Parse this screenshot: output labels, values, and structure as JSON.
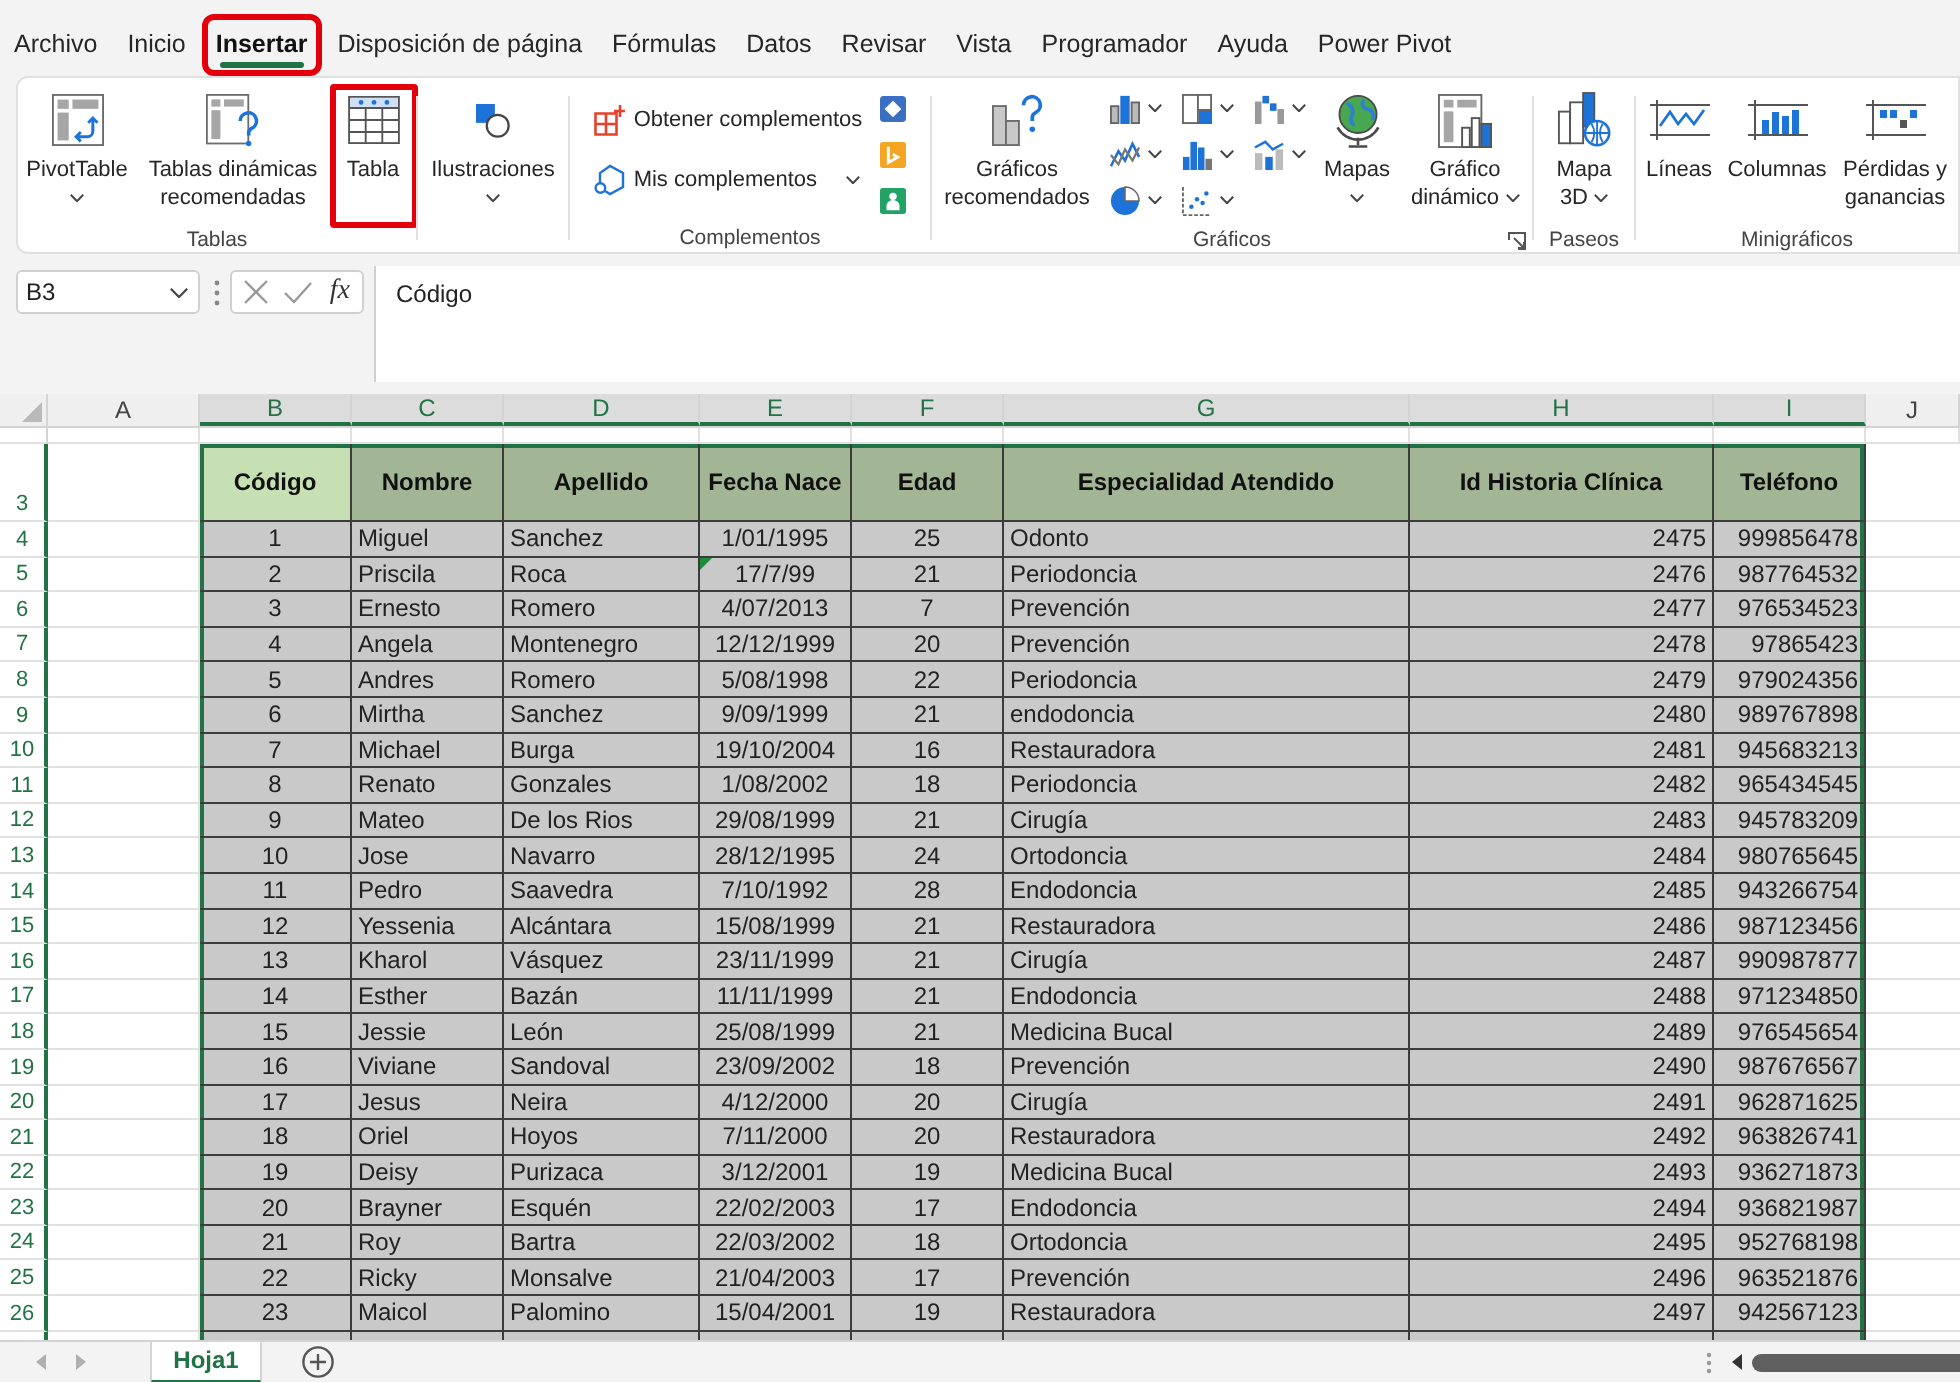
{
  "menu_tabs": [
    {
      "label": "Archivo",
      "selected": false,
      "highlighted": false
    },
    {
      "label": "Inicio",
      "selected": false,
      "highlighted": false
    },
    {
      "label": "Insertar",
      "selected": true,
      "highlighted": true
    },
    {
      "label": "Disposición de página",
      "selected": false,
      "highlighted": false
    },
    {
      "label": "Fórmulas",
      "selected": false,
      "highlighted": false
    },
    {
      "label": "Datos",
      "selected": false,
      "highlighted": false
    },
    {
      "label": "Revisar",
      "selected": false,
      "highlighted": false
    },
    {
      "label": "Vista",
      "selected": false,
      "highlighted": false
    },
    {
      "label": "Programador",
      "selected": false,
      "highlighted": false
    },
    {
      "label": "Ayuda",
      "selected": false,
      "highlighted": false
    },
    {
      "label": "Power Pivot",
      "selected": false,
      "highlighted": false
    }
  ],
  "ribbon_groups": [
    {
      "label": "Tablas",
      "dialog_launcher": false,
      "buttons": [
        {
          "kind": "large",
          "label": "PivotTable",
          "dropdown": true,
          "highlighted": false
        },
        {
          "kind": "large",
          "label": "Tablas dinámicas recomendadas",
          "dropdown": false,
          "highlighted": false
        },
        {
          "kind": "large",
          "label": "Tabla",
          "dropdown": false,
          "highlighted": true
        }
      ]
    },
    {
      "dialog_launcher": false,
      "buttons": [
        {
          "kind": "large",
          "label": "Ilustraciones",
          "dropdown": true,
          "highlighted": false
        }
      ]
    },
    {
      "label": "Complementos",
      "dialog_launcher": false,
      "buttons": [
        {
          "kind": "small",
          "label": "Obtener complementos",
          "dropdown": false,
          "highlighted": false
        },
        {
          "kind": "small",
          "label": "Mis complementos",
          "dropdown": true,
          "highlighted": false
        },
        {
          "kind": "icon",
          "dropdown": false,
          "highlighted": false
        },
        {
          "kind": "icon",
          "dropdown": false,
          "highlighted": false
        },
        {
          "kind": "icon",
          "dropdown": false,
          "highlighted": false
        }
      ]
    },
    {
      "label": "Gráficos",
      "dialog_launcher": true,
      "buttons": [
        {
          "kind": "large",
          "label": "Gráficos recomendados",
          "dropdown": false,
          "highlighted": false
        },
        {
          "kind": "icon",
          "dropdown": true,
          "highlighted": false
        },
        {
          "kind": "icon",
          "dropdown": true,
          "highlighted": false
        },
        {
          "kind": "icon",
          "dropdown": true,
          "highlighted": false
        },
        {
          "kind": "icon",
          "dropdown": true,
          "highlighted": false
        },
        {
          "kind": "icon",
          "dropdown": true,
          "highlighted": false
        },
        {
          "kind": "icon",
          "dropdown": true,
          "highlighted": false
        },
        {
          "kind": "icon",
          "dropdown": true,
          "highlighted": false
        },
        {
          "kind": "icon",
          "dropdown": true,
          "highlighted": false
        },
        {
          "kind": "large",
          "label": "Mapas",
          "dropdown": true,
          "highlighted": false
        },
        {
          "kind": "large",
          "label": "Gráfico dinámico",
          "dropdown": true,
          "highlighted": false
        }
      ]
    },
    {
      "label": "Paseos",
      "dialog_launcher": false,
      "buttons": [
        {
          "kind": "large",
          "label": "Mapa 3D",
          "dropdown": true,
          "highlighted": false
        }
      ]
    },
    {
      "label": "Minigráficos",
      "dialog_launcher": false,
      "buttons": [
        {
          "kind": "large",
          "label": "Líneas",
          "dropdown": false,
          "highlighted": false
        },
        {
          "kind": "large",
          "label": "Columnas",
          "dropdown": false,
          "highlighted": false
        },
        {
          "kind": "large",
          "label": "Pérdidas y ganancias",
          "dropdown": false,
          "highlighted": false
        }
      ]
    }
  ],
  "formula_bar": {
    "name_box": "B3",
    "function_button": "fx",
    "formula": "Código"
  },
  "column_headers": [
    {
      "label": "A",
      "selected": false
    },
    {
      "label": "B",
      "selected": true
    },
    {
      "label": "C",
      "selected": true
    },
    {
      "label": "D",
      "selected": true
    },
    {
      "label": "E",
      "selected": true
    },
    {
      "label": "F",
      "selected": true
    },
    {
      "label": "G",
      "selected": true
    },
    {
      "label": "H",
      "selected": true
    },
    {
      "label": "I",
      "selected": true
    },
    {
      "label": "J",
      "selected": false
    }
  ],
  "table": {
    "header": {
      "row_number": "3",
      "selected": true,
      "cells": [
        {
          "text": "Código",
          "active": true
        },
        {
          "text": "Nombre",
          "active": false
        },
        {
          "text": "Apellido",
          "active": false
        },
        {
          "text": "Fecha Nace",
          "active": false
        },
        {
          "text": "Edad",
          "active": false
        },
        {
          "text": "Especialidad Atendido",
          "active": false
        },
        {
          "text": "Id Historia Clínica",
          "active": false
        },
        {
          "text": "Teléfono",
          "active": false
        }
      ]
    },
    "rows": [
      {
        "row_number": "4",
        "selected": true,
        "warning": false,
        "cells": [
          "1",
          "Miguel",
          "Sanchez",
          "1/01/1995",
          "25",
          "Odonto",
          "2475",
          "999856478"
        ]
      },
      {
        "row_number": "5",
        "selected": true,
        "warning": true,
        "cells": [
          "2",
          "Priscila",
          "Roca",
          "17/7/99",
          "21",
          "Periodoncia",
          "2476",
          "987764532"
        ]
      },
      {
        "row_number": "6",
        "selected": true,
        "warning": false,
        "cells": [
          "3",
          "Ernesto",
          "Romero",
          "4/07/2013",
          "7",
          "Prevención",
          "2477",
          "976534523"
        ]
      },
      {
        "row_number": "7",
        "selected": true,
        "warning": false,
        "cells": [
          "4",
          "Angela",
          "Montenegro",
          "12/12/1999",
          "20",
          "Prevención",
          "2478",
          "97865423"
        ]
      },
      {
        "row_number": "8",
        "selected": true,
        "warning": false,
        "cells": [
          "5",
          "Andres",
          "Romero",
          "5/08/1998",
          "22",
          "Periodoncia",
          "2479",
          "979024356"
        ]
      },
      {
        "row_number": "9",
        "selected": true,
        "warning": false,
        "cells": [
          "6",
          "Mirtha",
          "Sanchez",
          "9/09/1999",
          "21",
          "endodoncia",
          "2480",
          "989767898"
        ]
      },
      {
        "row_number": "10",
        "selected": true,
        "warning": false,
        "cells": [
          "7",
          "Michael",
          "Burga",
          "19/10/2004",
          "16",
          "Restauradora",
          "2481",
          "945683213"
        ]
      },
      {
        "row_number": "11",
        "selected": true,
        "warning": false,
        "cells": [
          "8",
          "Renato",
          "Gonzales",
          "1/08/2002",
          "18",
          "Periodoncia",
          "2482",
          "965434545"
        ]
      },
      {
        "row_number": "12",
        "selected": true,
        "warning": false,
        "cells": [
          "9",
          "Mateo",
          "De los Rios",
          "29/08/1999",
          "21",
          "Cirugía",
          "2483",
          "945783209"
        ]
      },
      {
        "row_number": "13",
        "selected": true,
        "warning": false,
        "cells": [
          "10",
          "Jose",
          "Navarro",
          "28/12/1995",
          "24",
          "Ortodoncia",
          "2484",
          "980765645"
        ]
      },
      {
        "row_number": "14",
        "selected": true,
        "warning": false,
        "cells": [
          "11",
          "Pedro",
          "Saavedra",
          "7/10/1992",
          "28",
          "Endodoncia",
          "2485",
          "943266754"
        ]
      },
      {
        "row_number": "15",
        "selected": true,
        "warning": false,
        "cells": [
          "12",
          "Yessenia",
          "Alcántara",
          "15/08/1999",
          "21",
          "Restauradora",
          "2486",
          "987123456"
        ]
      },
      {
        "row_number": "16",
        "selected": true,
        "warning": false,
        "cells": [
          "13",
          "Kharol",
          "Vásquez",
          "23/11/1999",
          "21",
          "Cirugía",
          "2487",
          "990987877"
        ]
      },
      {
        "row_number": "17",
        "selected": true,
        "warning": false,
        "cells": [
          "14",
          "Esther",
          "Bazán",
          "11/11/1999",
          "21",
          "Endodoncia",
          "2488",
          "971234850"
        ]
      },
      {
        "row_number": "18",
        "selected": true,
        "warning": false,
        "cells": [
          "15",
          "Jessie",
          "León",
          "25/08/1999",
          "21",
          "Medicina Bucal",
          "2489",
          "976545654"
        ]
      },
      {
        "row_number": "19",
        "selected": true,
        "warning": false,
        "cells": [
          "16",
          "Viviane",
          "Sandoval",
          "23/09/2002",
          "18",
          "Prevención",
          "2490",
          "987676567"
        ]
      },
      {
        "row_number": "20",
        "selected": true,
        "warning": false,
        "cells": [
          "17",
          "Jesus",
          "Neira",
          "4/12/2000",
          "20",
          "Cirugía",
          "2491",
          "962871625"
        ]
      },
      {
        "row_number": "21",
        "selected": true,
        "warning": false,
        "cells": [
          "18",
          "Oriel",
          "Hoyos",
          "7/11/2000",
          "20",
          "Restauradora",
          "2492",
          "963826741"
        ]
      },
      {
        "row_number": "22",
        "selected": true,
        "warning": false,
        "cells": [
          "19",
          "Deisy",
          "Purizaca",
          "3/12/2001",
          "19",
          "Medicina Bucal",
          "2493",
          "936271873"
        ]
      },
      {
        "row_number": "23",
        "selected": true,
        "warning": false,
        "cells": [
          "20",
          "Brayner",
          "Esquén",
          "22/02/2003",
          "17",
          "Endodoncia",
          "2494",
          "936821987"
        ]
      },
      {
        "row_number": "24",
        "selected": true,
        "warning": false,
        "cells": [
          "21",
          "Roy",
          "Bartra",
          "22/03/2002",
          "18",
          "Ortodoncia",
          "2495",
          "952768198"
        ]
      },
      {
        "row_number": "25",
        "selected": true,
        "warning": false,
        "cells": [
          "22",
          "Ricky",
          "Monsalve",
          "21/04/2003",
          "17",
          "Prevención",
          "2496",
          "963521876"
        ]
      },
      {
        "row_number": "26",
        "selected": true,
        "warning": false,
        "cells": [
          "23",
          "Maicol",
          "Palomino",
          "15/04/2001",
          "19",
          "Restauradora",
          "2497",
          "942567123"
        ]
      }
    ]
  },
  "sheet_tabs": [
    {
      "label": "Hoja1",
      "selected": true
    }
  ]
}
